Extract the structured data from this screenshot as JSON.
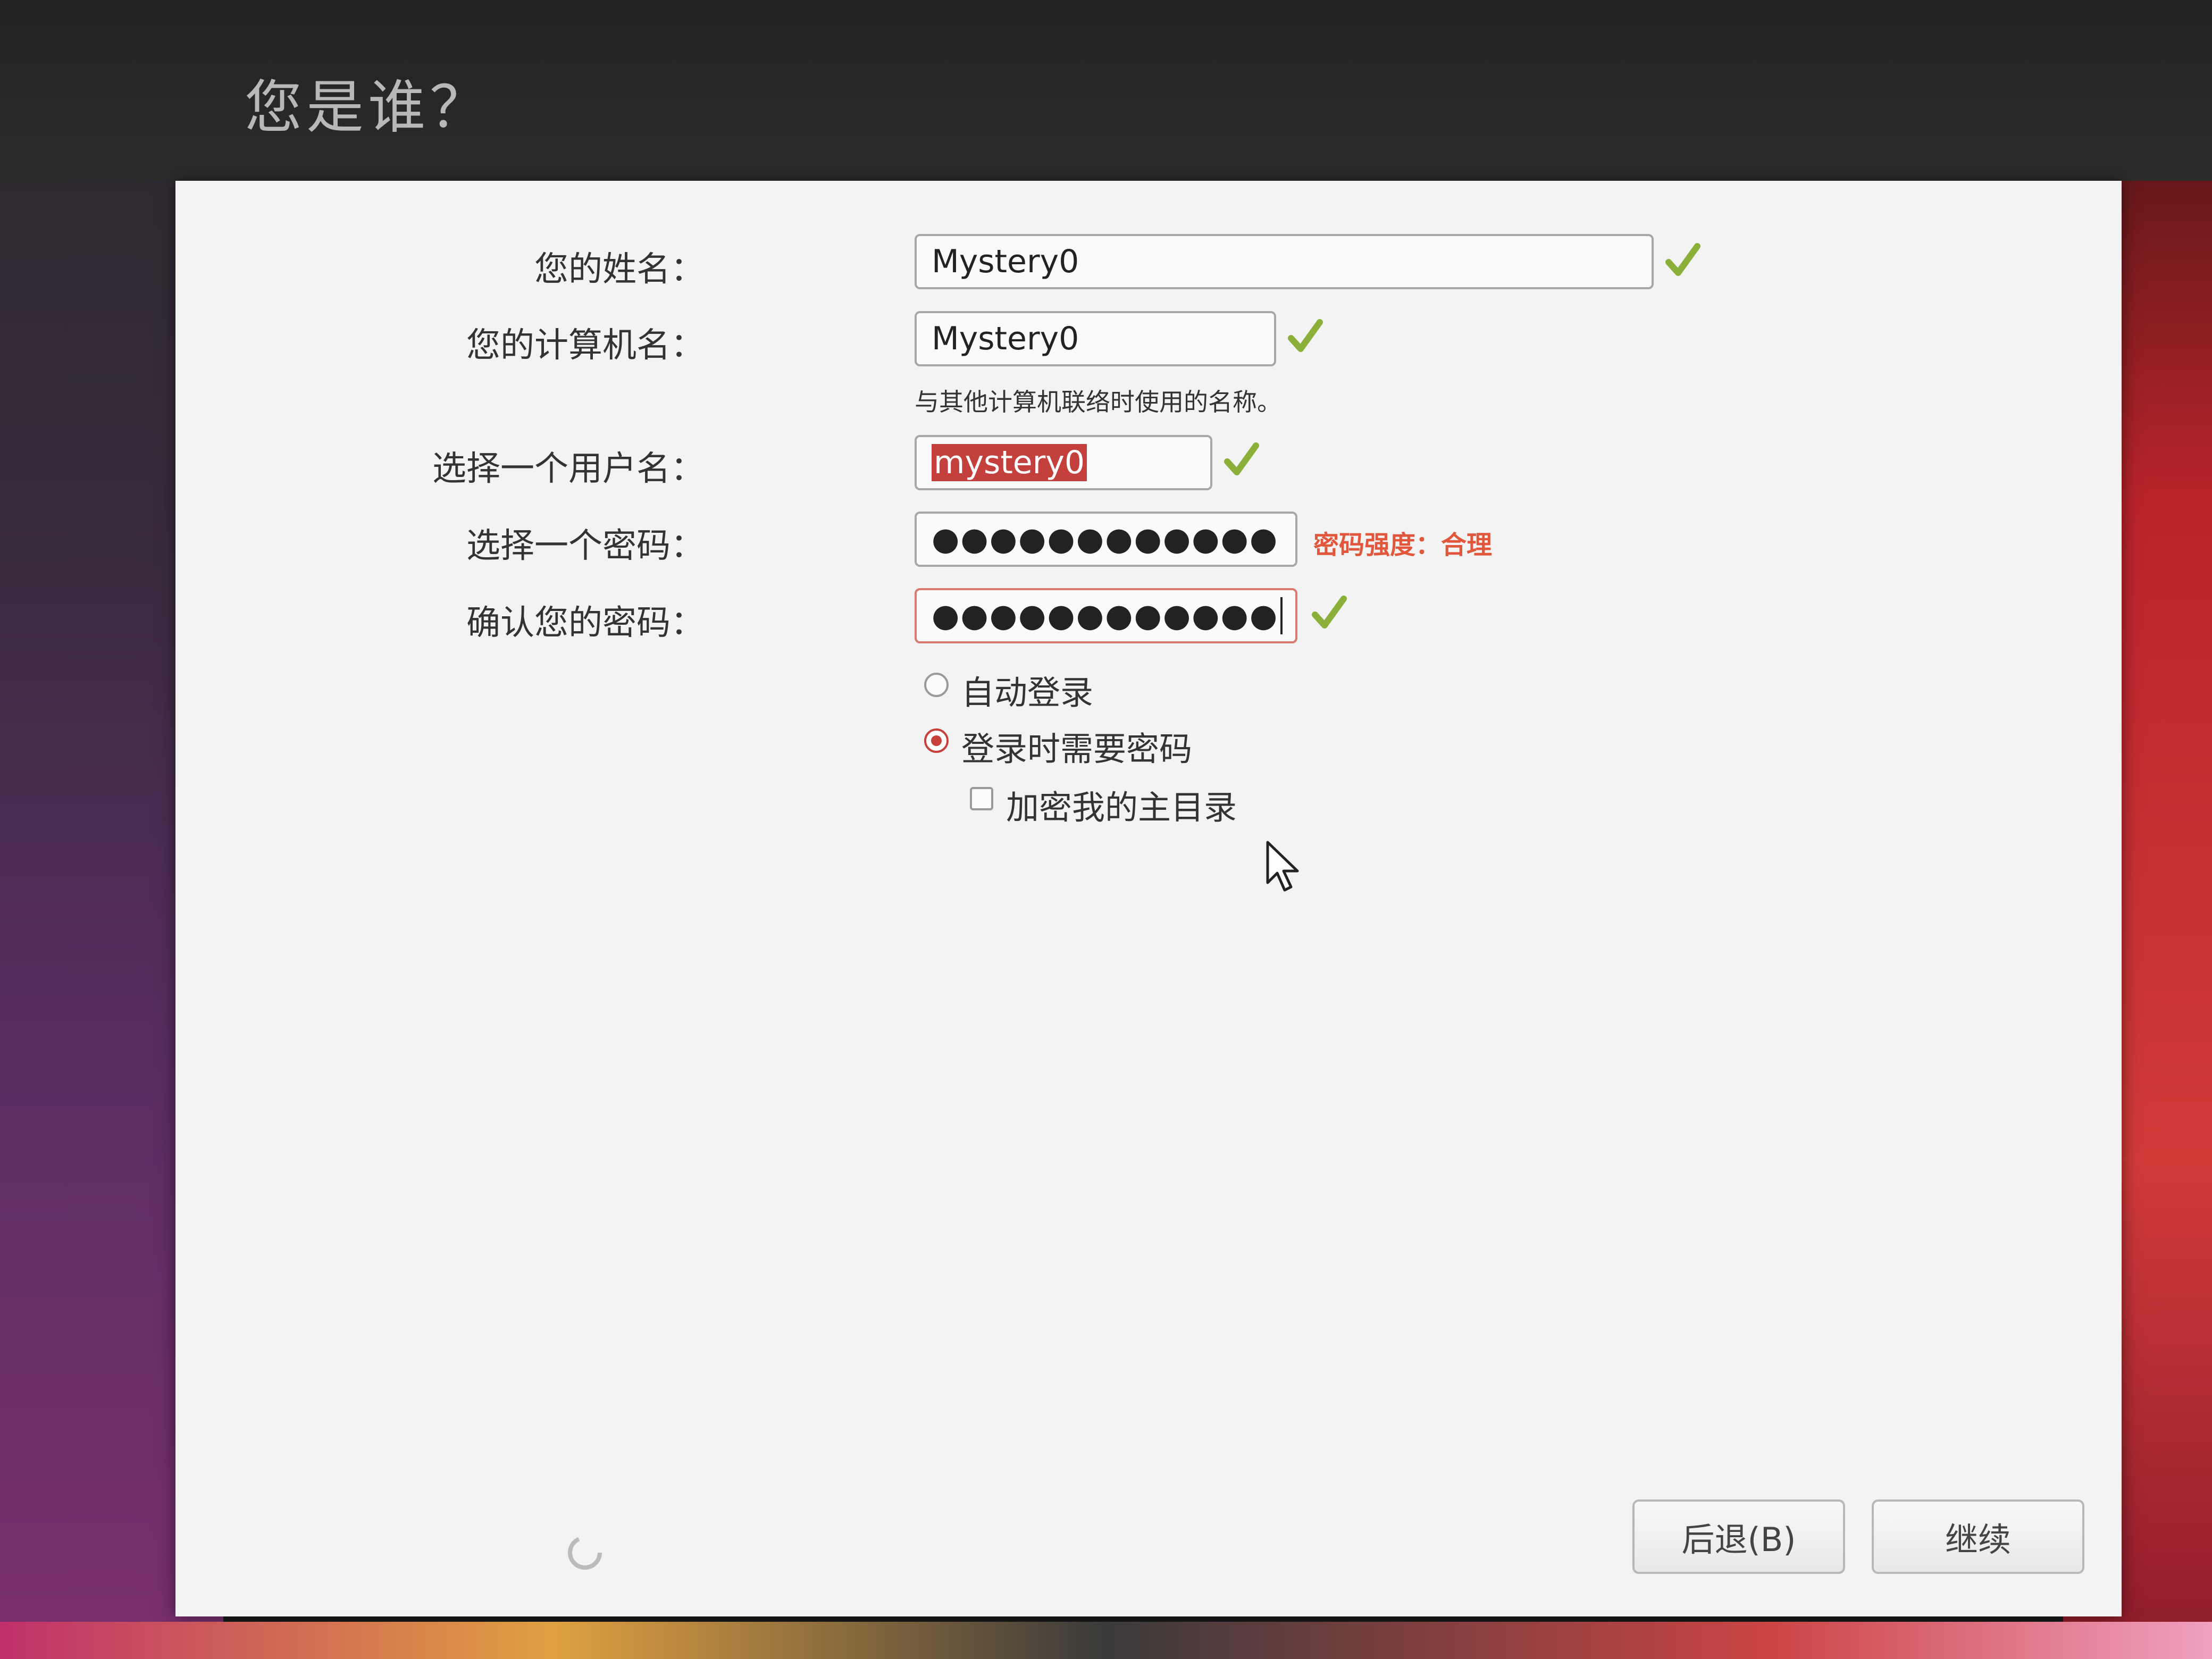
{
  "header": {
    "title": "您是谁？"
  },
  "form": {
    "name": {
      "label": "您的姓名：",
      "value": "Mystery0"
    },
    "computer": {
      "label": "您的计算机名：",
      "value": "Mystery0",
      "hint": "与其他计算机联络时使用的名称。"
    },
    "username": {
      "label": "选择一个用户名：",
      "value": "mystery0"
    },
    "password": {
      "label": "选择一个密码：",
      "masked": "●●●●●●●●●●●●",
      "strength": "密码强度：合理"
    },
    "confirm": {
      "label": "确认您的密码：",
      "masked": "●●●●●●●●●●●●"
    },
    "options": {
      "auto_login": "自动登录",
      "require_password": "登录时需要密码",
      "encrypt_home": "加密我的主目录",
      "selected": "require_password"
    }
  },
  "buttons": {
    "back": "后退(B)",
    "continue": "继续"
  },
  "colors": {
    "accent": "#c7403a",
    "check": "#8ab03a",
    "strength": "#e2573c"
  },
  "icons": [
    "check-icon",
    "mouse-cursor-icon",
    "spinner-icon"
  ]
}
